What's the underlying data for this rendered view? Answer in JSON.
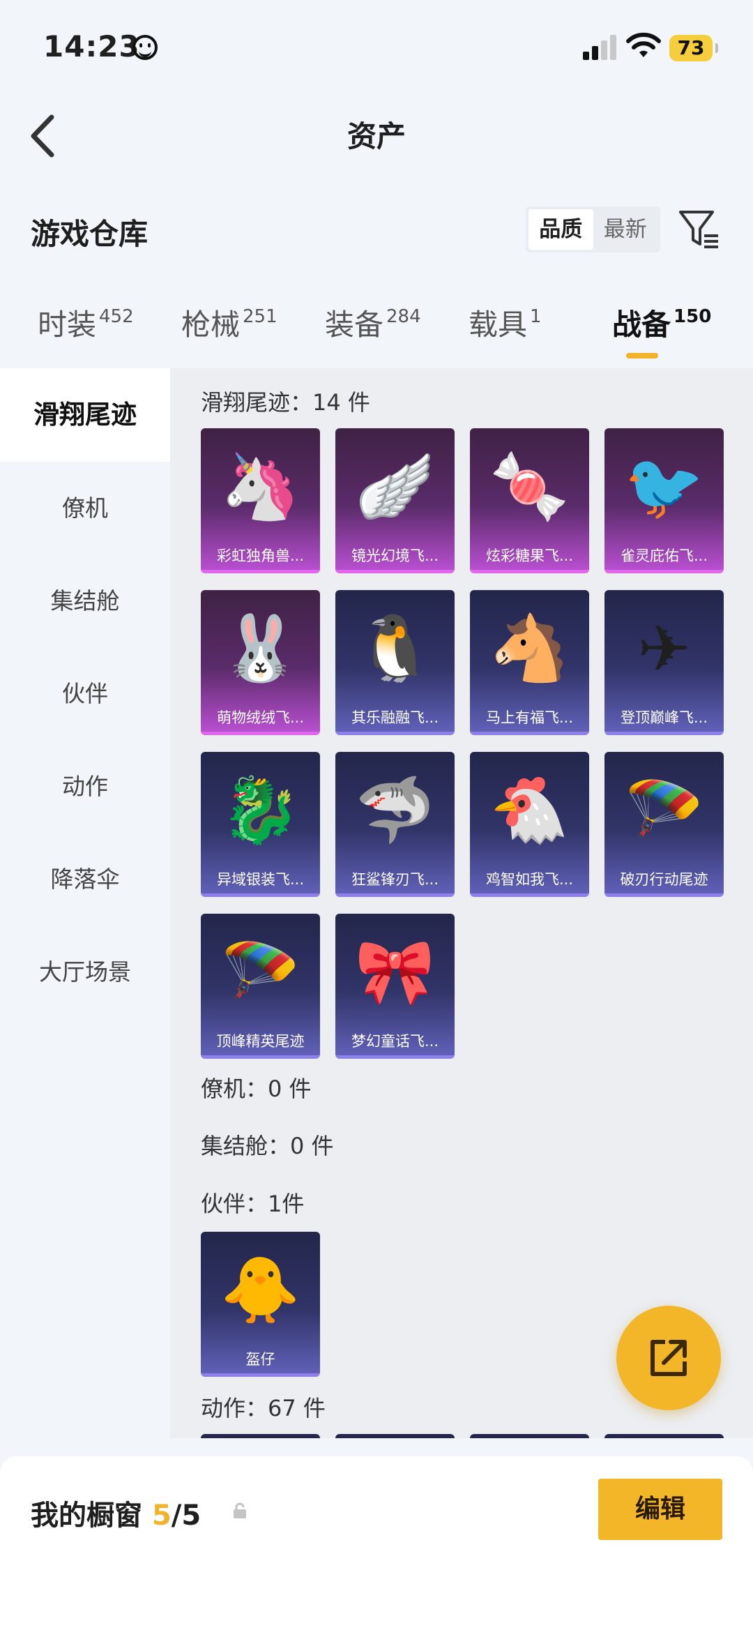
{
  "status": {
    "time": "14:23",
    "battery": "73"
  },
  "header": {
    "title": "资产"
  },
  "warehouse": {
    "title": "游戏仓库",
    "sort_options": [
      "品质",
      "最新"
    ],
    "sort_selected": "品质"
  },
  "tabs": [
    {
      "label": "时装",
      "count": "452"
    },
    {
      "label": "枪械",
      "count": "251"
    },
    {
      "label": "装备",
      "count": "284"
    },
    {
      "label": "载具",
      "count": "1"
    },
    {
      "label": "战备",
      "count": "150"
    }
  ],
  "active_tab": "战备",
  "sidebar": [
    "滑翔尾迹",
    "僚机",
    "集结舱",
    "伙伴",
    "动作",
    "降落伞",
    "大厅场景"
  ],
  "categories": {
    "glide_trail": {
      "title": "滑翔尾迹：14 件"
    },
    "wingman": {
      "title": "僚机：0 件"
    },
    "pod": {
      "title": "集结舱：0 件"
    },
    "partner": {
      "title": "伙伴：1件"
    },
    "emote": {
      "title": "动作：67 件"
    }
  },
  "glide_items": [
    {
      "name": "彩虹独角兽...",
      "rarity": "purple",
      "icon": "unicorn-mirror-icon",
      "glyph": "🦄"
    },
    {
      "name": "镜光幻境飞...",
      "rarity": "purple",
      "icon": "crystal-wing-icon",
      "glyph": "🪽"
    },
    {
      "name": "炫彩糖果飞...",
      "rarity": "purple",
      "icon": "candy-icon",
      "glyph": "🍬"
    },
    {
      "name": "雀灵庇佑飞...",
      "rarity": "purple",
      "icon": "golden-bird-icon",
      "glyph": "🐦"
    },
    {
      "name": "萌物绒绒飞...",
      "rarity": "purple",
      "icon": "bunny-icon",
      "glyph": "🐰"
    },
    {
      "name": "其乐融融飞...",
      "rarity": "blue",
      "icon": "penguin-icon",
      "glyph": "🐧"
    },
    {
      "name": "马上有福飞...",
      "rarity": "blue",
      "icon": "horse-icon",
      "glyph": "🐴"
    },
    {
      "name": "登顶巅峰飞...",
      "rarity": "blue",
      "icon": "jet-icon",
      "glyph": "✈"
    },
    {
      "name": "异域银装飞...",
      "rarity": "blue",
      "icon": "dragon-wing-icon",
      "glyph": "🐉"
    },
    {
      "name": "狂鲨锋刃飞...",
      "rarity": "blue",
      "icon": "shark-icon",
      "glyph": "🦈"
    },
    {
      "name": "鸡智如我飞...",
      "rarity": "blue",
      "icon": "chicken-icon",
      "glyph": "🐔"
    },
    {
      "name": "破刃行动尾迹",
      "rarity": "blue",
      "icon": "smoke-trail-icon",
      "glyph": "🪂"
    },
    {
      "name": "顶峰精英尾迹",
      "rarity": "blue",
      "icon": "smoke-trail-icon",
      "glyph": "🪂"
    },
    {
      "name": "梦幻童话飞...",
      "rarity": "blue",
      "icon": "fairy-bed-icon",
      "glyph": "🎀"
    }
  ],
  "partner_items": [
    {
      "name": "盔仔",
      "rarity": "blue",
      "icon": "helmet-chick-icon",
      "glyph": "🐥"
    }
  ],
  "showcase": {
    "label": "我的橱窗",
    "used": "5",
    "total": "/5",
    "edit_label": "编辑"
  },
  "colors": {
    "accent": "#f3b629",
    "purple_rarity": "#b84fd0",
    "blue_rarity": "#6060b8"
  }
}
